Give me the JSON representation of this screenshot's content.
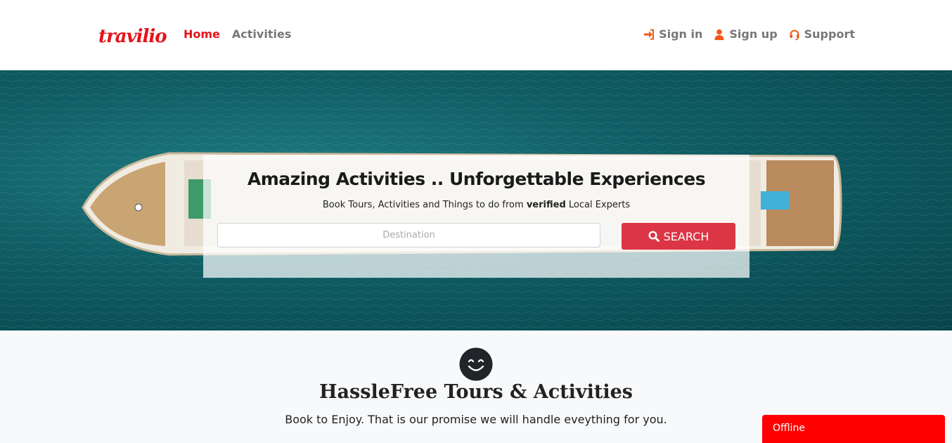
{
  "brand": {
    "logo_text": "travilio",
    "color": "#e8121a"
  },
  "nav": {
    "left": [
      {
        "label": "Home",
        "active": true
      },
      {
        "label": "Activities",
        "active": false
      }
    ],
    "right": [
      {
        "label": "Sign in",
        "icon": "sign-in-icon"
      },
      {
        "label": "Sign up",
        "icon": "user-icon"
      },
      {
        "label": "Support",
        "icon": "headset-icon"
      }
    ]
  },
  "hero": {
    "headline": "Amazing Activities .. Unforgettable Experiences",
    "sub_prefix": "Book Tours, Activities and Things to do from",
    "sub_bold": "verified",
    "sub_suffix": "Local Experts",
    "search": {
      "placeholder": "Destination",
      "value": "",
      "button_label": "SEARCH",
      "button_icon": "search-icon"
    }
  },
  "feature": {
    "icon": "smile-icon",
    "title": "HassleFree Tours & Activities",
    "text": "Book to Enjoy. That is our promise we will handle eveything for you."
  },
  "chat": {
    "status": "Offline"
  },
  "colors": {
    "accent": "#e8121a",
    "button": "#dc3545",
    "nav_text": "#777777",
    "offline": "#ff0000"
  }
}
